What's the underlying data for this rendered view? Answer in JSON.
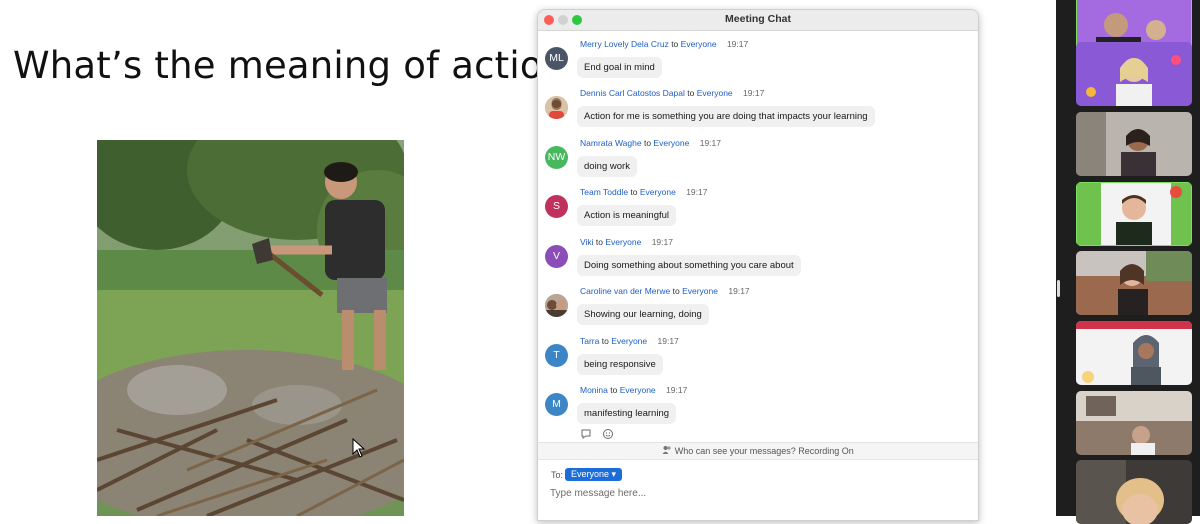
{
  "slide": {
    "title": "What’s the meaning of action?"
  },
  "chat": {
    "window_title": "Meeting Chat",
    "messages": [
      {
        "initials": "ML",
        "sender": "Merry Lovely Dela Cruz",
        "to": "to",
        "target": "Everyone",
        "time": "19:17",
        "text": "End goal in mind",
        "avatar_color": "#4a5668"
      },
      {
        "initials": "",
        "sender": "Dennis Carl Catostos Dapal",
        "to": "to",
        "target": "Everyone",
        "time": "19:17",
        "text": "Action for me is something you are doing that impacts your learning",
        "avatar_color": "#c9a17d"
      },
      {
        "initials": "NW",
        "sender": "Namrata Waghe",
        "to": "to",
        "target": "Everyone",
        "time": "19:17",
        "text": "doing work",
        "avatar_color": "#48b85f"
      },
      {
        "initials": "S",
        "sender": "Team Toddle",
        "to": "to",
        "target": "Everyone",
        "time": "19:17",
        "text": "Action is meaningful",
        "avatar_color": "#c0325d"
      },
      {
        "initials": "V",
        "sender": "Viki",
        "to": "to",
        "target": "Everyone",
        "time": "19:17",
        "text": "Doing something about something you care about",
        "avatar_color": "#8b4db8"
      },
      {
        "initials": "",
        "sender": "Caroline van der Merwe",
        "to": "to",
        "target": "Everyone",
        "time": "19:17",
        "text": "Showing our learning, doing",
        "avatar_color": "#a57f6a"
      },
      {
        "initials": "T",
        "sender": "Tarra",
        "to": "to",
        "target": "Everyone",
        "time": "19:17",
        "text": "being responsive",
        "avatar_color": "#3d86c6"
      },
      {
        "initials": "M",
        "sender": "Monina",
        "to": "to",
        "target": "Everyone",
        "time": "19:17",
        "text": "manifesting learning",
        "avatar_color": "#3d86c6"
      }
    ],
    "notice": "Who can see your messages? Recording On",
    "composer": {
      "to_label": "To:",
      "recipient": "Everyone ▾",
      "placeholder": "Type message here..."
    }
  },
  "colors": {
    "link_blue": "#1e5fc6",
    "pill_blue": "#1d6dd9"
  }
}
